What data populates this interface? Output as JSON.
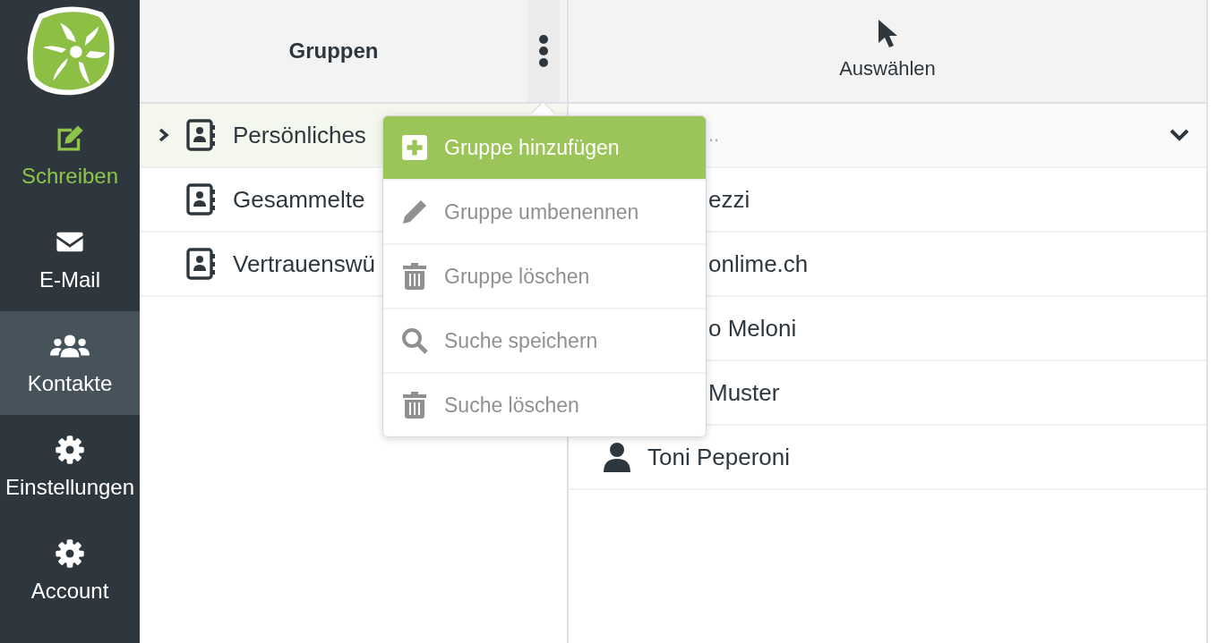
{
  "sidebar": {
    "items": [
      {
        "label": "Schreiben",
        "kind": "compose",
        "selected": false
      },
      {
        "label": "E-Mail",
        "kind": "mail",
        "selected": false
      },
      {
        "label": "Kontakte",
        "kind": "contacts",
        "selected": true
      },
      {
        "label": "Einstellungen",
        "kind": "settings",
        "selected": false
      },
      {
        "label": "Account",
        "kind": "settings",
        "selected": false
      }
    ]
  },
  "groups": {
    "title": "Gruppen",
    "items": [
      {
        "label": "Persönliches",
        "selected": true,
        "expanded": false
      },
      {
        "label": "Gesammelte",
        "selected": false
      },
      {
        "label": "Vertrauenswü",
        "selected": false
      }
    ]
  },
  "menu": {
    "items": [
      {
        "label": "Gruppe hinzufügen",
        "kind": "add",
        "selected": true,
        "disabled": false
      },
      {
        "label": "Gruppe umbenennen",
        "kind": "rename",
        "selected": false,
        "disabled": true
      },
      {
        "label": "Gruppe löschen",
        "kind": "delete",
        "selected": false,
        "disabled": true
      },
      {
        "label": "Suche speichern",
        "kind": "search",
        "selected": false,
        "disabled": true
      },
      {
        "label": "Suche löschen",
        "kind": "delete",
        "selected": false,
        "disabled": true
      }
    ]
  },
  "contacts": {
    "select_label": "Auswählen",
    "filter_value": "..",
    "rows": [
      {
        "name": "ezzi"
      },
      {
        "name": "onlime.ch"
      },
      {
        "name": "o Meloni"
      },
      {
        "name": "Muster"
      },
      {
        "name": "Toni Peperoni"
      }
    ]
  }
}
